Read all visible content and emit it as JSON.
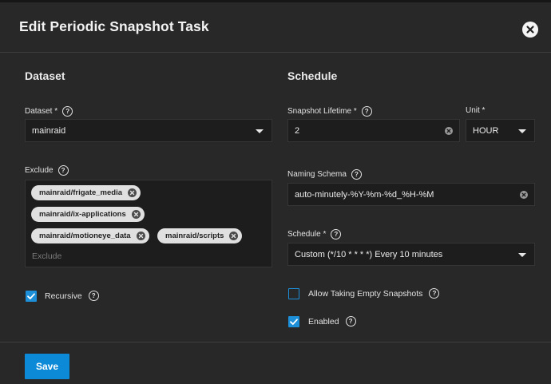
{
  "dialog": {
    "title": "Edit Periodic Snapshot Task",
    "close_icon": "close-icon",
    "save_label": "Save"
  },
  "dataset_section": {
    "title": "Dataset",
    "dataset": {
      "label": "Dataset *",
      "value": "mainraid"
    },
    "exclude": {
      "label": "Exclude",
      "chips": [
        "mainraid/frigate_media",
        "mainraid/ix-applications",
        "mainraid/motioneye_data",
        "mainraid/scripts"
      ],
      "placeholder": "Exclude"
    },
    "recursive": {
      "label": "Recursive",
      "checked": true
    }
  },
  "schedule_section": {
    "title": "Schedule",
    "snapshot_lifetime": {
      "label": "Snapshot Lifetime *",
      "value": "2"
    },
    "unit": {
      "label": "Unit *",
      "value": "HOUR"
    },
    "naming_schema": {
      "label": "Naming Schema",
      "value": "auto-minutely-%Y-%m-%d_%H-%M"
    },
    "schedule": {
      "label": "Schedule *",
      "value": "Custom (*/10 * * * *) Every 10 minutes"
    },
    "allow_empty": {
      "label": "Allow Taking Empty Snapshots",
      "checked": false
    },
    "enabled": {
      "label": "Enabled",
      "checked": true
    }
  },
  "colors": {
    "accent": "#0d8ad7",
    "background": "#282828",
    "field": "#1d1d1d"
  }
}
